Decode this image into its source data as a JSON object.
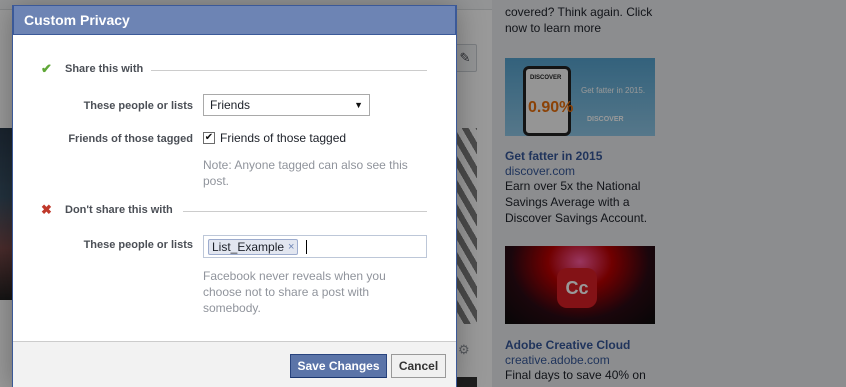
{
  "background": {
    "ads": [
      {
        "top_text": "covered? Think again. Click now to learn more"
      },
      {
        "image_text": {
          "brand": "DISCOVER",
          "rate": "0.90%",
          "tagline": "Get fatter in 2015.",
          "logo": "DISCOVER"
        },
        "title": "Get fatter in 2015",
        "domain": "discover.com",
        "body": "Earn over 5x the National Savings Average with a Discover Savings Account."
      },
      {
        "image_text": {
          "logo": "Cc"
        },
        "title": "Adobe Creative Cloud",
        "domain": "creative.adobe.com",
        "body": "Final days to save 40% on"
      }
    ]
  },
  "dialog": {
    "title": "Custom Privacy",
    "share_section": {
      "heading": "Share this with",
      "people_label": "These people or lists",
      "people_value": "Friends",
      "tagged_label": "Friends of those tagged",
      "tagged_checkbox_label": "Friends of those tagged",
      "tagged_checked": true,
      "note": "Note: Anyone tagged can also see this post."
    },
    "dont_share_section": {
      "heading": "Don't share this with",
      "people_label": "These people or lists",
      "tokens": [
        "List_Example"
      ],
      "note": "Facebook never reveals when you choose not to share a post with somebody."
    },
    "footer": {
      "save_label": "Save Changes",
      "cancel_label": "Cancel"
    }
  },
  "colors": {
    "header_bg": "#6d84b4",
    "primary_button": "#5b74a8",
    "link": "#365899",
    "check_green": "#5fa737",
    "cross_red": "#c0392b"
  },
  "icons": {
    "share_icon": "check-icon",
    "dont_share_icon": "cross-icon",
    "select_arrow": "caret-down-icon",
    "token_remove": "close-icon",
    "edit": "pencil-icon",
    "settings": "gear-icon"
  }
}
